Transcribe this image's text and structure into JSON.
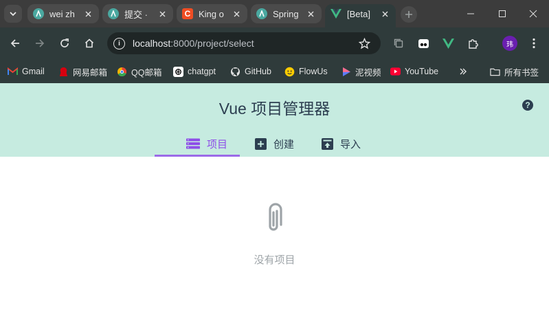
{
  "browser": {
    "tabs": [
      {
        "label": "wei zh",
        "favicon": "circle-a-icon",
        "favicon_color": "#4aa8a0"
      },
      {
        "label": "提交 · ",
        "favicon": "circle-a-icon",
        "favicon_color": "#4aa8a0"
      },
      {
        "label": "King o",
        "favicon": "c-logo-icon",
        "favicon_color": "#f04d23"
      },
      {
        "label": "Spring",
        "favicon": "circle-a-icon",
        "favicon_color": "#4aa8a0"
      },
      {
        "label": "[Beta]",
        "favicon": "vue-logo-icon",
        "favicon_color": "#41b883",
        "active": true
      }
    ],
    "address": {
      "host": "localhost",
      "path": ":8000/project/select"
    },
    "profile_initial": "玮",
    "bookmarks": [
      {
        "label": "Gmail",
        "icon": "gmail-icon"
      },
      {
        "label": "网易邮箱",
        "icon": "netease-icon"
      },
      {
        "label": "QQ邮箱",
        "icon": "qq-mail-icon"
      },
      {
        "label": "chatgpt",
        "icon": "chatgpt-icon"
      },
      {
        "label": "GitHub",
        "icon": "github-icon"
      },
      {
        "label": "FlowUs",
        "icon": "flowus-icon"
      },
      {
        "label": "泥视频",
        "icon": "play-icon"
      },
      {
        "label": "YouTube",
        "icon": "youtube-icon"
      }
    ],
    "all_bookmarks_label": "所有书签"
  },
  "app": {
    "title": "Vue 项目管理器",
    "help_glyph": "?",
    "accent_color": "#8e4fe8",
    "header_bg": "#c6ebe0",
    "tabs": [
      {
        "label": "项目",
        "icon": "list-icon",
        "active": true
      },
      {
        "label": "创建",
        "icon": "plus-box-icon"
      },
      {
        "label": "导入",
        "icon": "upload-box-icon"
      }
    ],
    "empty_message": "没有项目"
  }
}
